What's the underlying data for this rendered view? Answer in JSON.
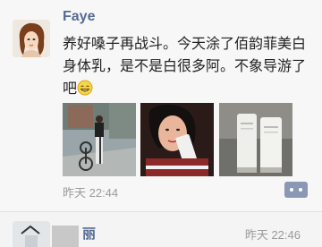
{
  "post": {
    "username": "Faye",
    "text": "养好嗓子再战斗。今天涂了佰韵菲美白身体乳，是不是白很多阿。不象导游了吧",
    "emoji": "grin-emoji",
    "photo_count": 3,
    "time": "昨天 22:44"
  },
  "next_post": {
    "username": "丽",
    "time": "昨天 22:46"
  },
  "colors": {
    "link": "#576b95",
    "meta": "#9a9a9a",
    "background": "#f7f7f7"
  }
}
